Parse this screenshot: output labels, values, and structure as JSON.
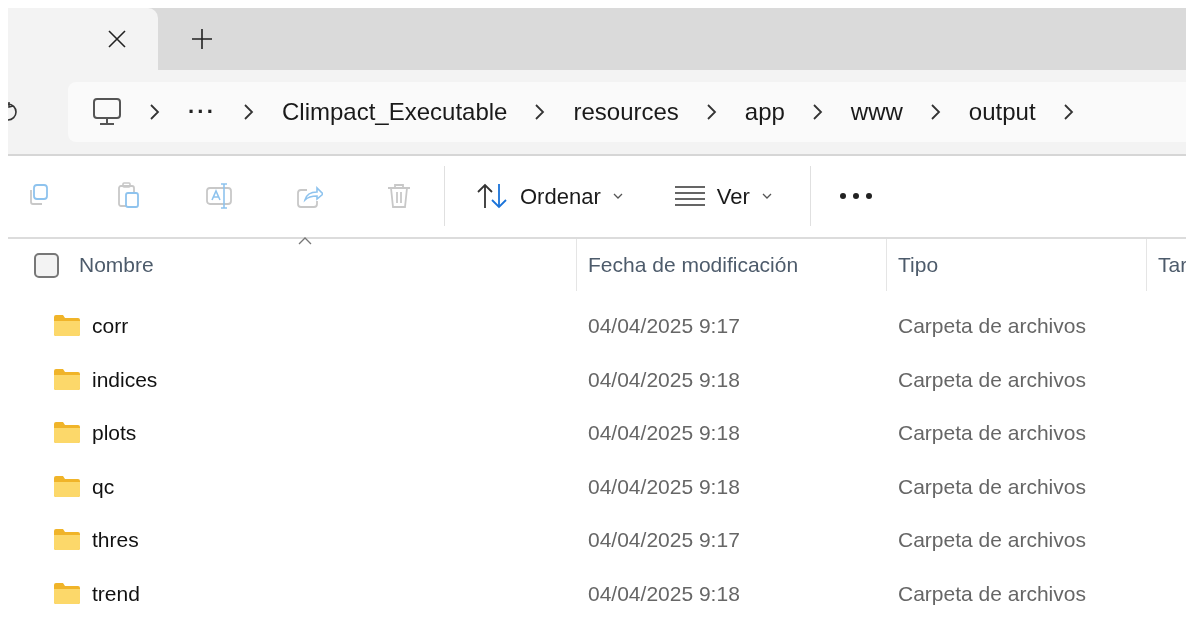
{
  "breadcrumb": {
    "items": [
      {
        "kind": "ellipsis",
        "label": "···"
      },
      {
        "kind": "folder",
        "label": "Climpact_Executable"
      },
      {
        "kind": "folder",
        "label": "resources"
      },
      {
        "kind": "folder",
        "label": "app"
      },
      {
        "kind": "folder",
        "label": "www"
      },
      {
        "kind": "folder",
        "label": "output"
      }
    ]
  },
  "toolbar": {
    "items": [
      {
        "kind": "copy",
        "disabled": true
      },
      {
        "kind": "paste",
        "disabled": true
      },
      {
        "kind": "rename",
        "disabled": true
      },
      {
        "kind": "share",
        "disabled": true
      },
      {
        "kind": "delete",
        "disabled": true
      },
      {
        "kind": "sort",
        "label": "Ordenar",
        "disabled": false
      },
      {
        "kind": "view",
        "label": "Ver",
        "disabled": false
      },
      {
        "kind": "more",
        "disabled": false
      }
    ]
  },
  "table": {
    "select_all": {
      "checked": false
    },
    "columns": [
      {
        "label": "Nombre",
        "sorted": true
      },
      {
        "label": "Fecha de modificación",
        "sorted": false
      },
      {
        "label": "Tipo",
        "sorted": false
      },
      {
        "label": "Tar",
        "sorted": false
      }
    ],
    "rows": [
      {
        "name": "corr",
        "modified": "04/04/2025 9:17",
        "type": "Carpeta de archivos"
      },
      {
        "name": "indices",
        "modified": "04/04/2025 9:18",
        "type": "Carpeta de archivos"
      },
      {
        "name": "plots",
        "modified": "04/04/2025 9:18",
        "type": "Carpeta de archivos"
      },
      {
        "name": "qc",
        "modified": "04/04/2025 9:18",
        "type": "Carpeta de archivos"
      },
      {
        "name": "thres",
        "modified": "04/04/2025 9:17",
        "type": "Carpeta de archivos"
      },
      {
        "name": "trend",
        "modified": "04/04/2025 9:18",
        "type": "Carpeta de archivos"
      }
    ]
  }
}
